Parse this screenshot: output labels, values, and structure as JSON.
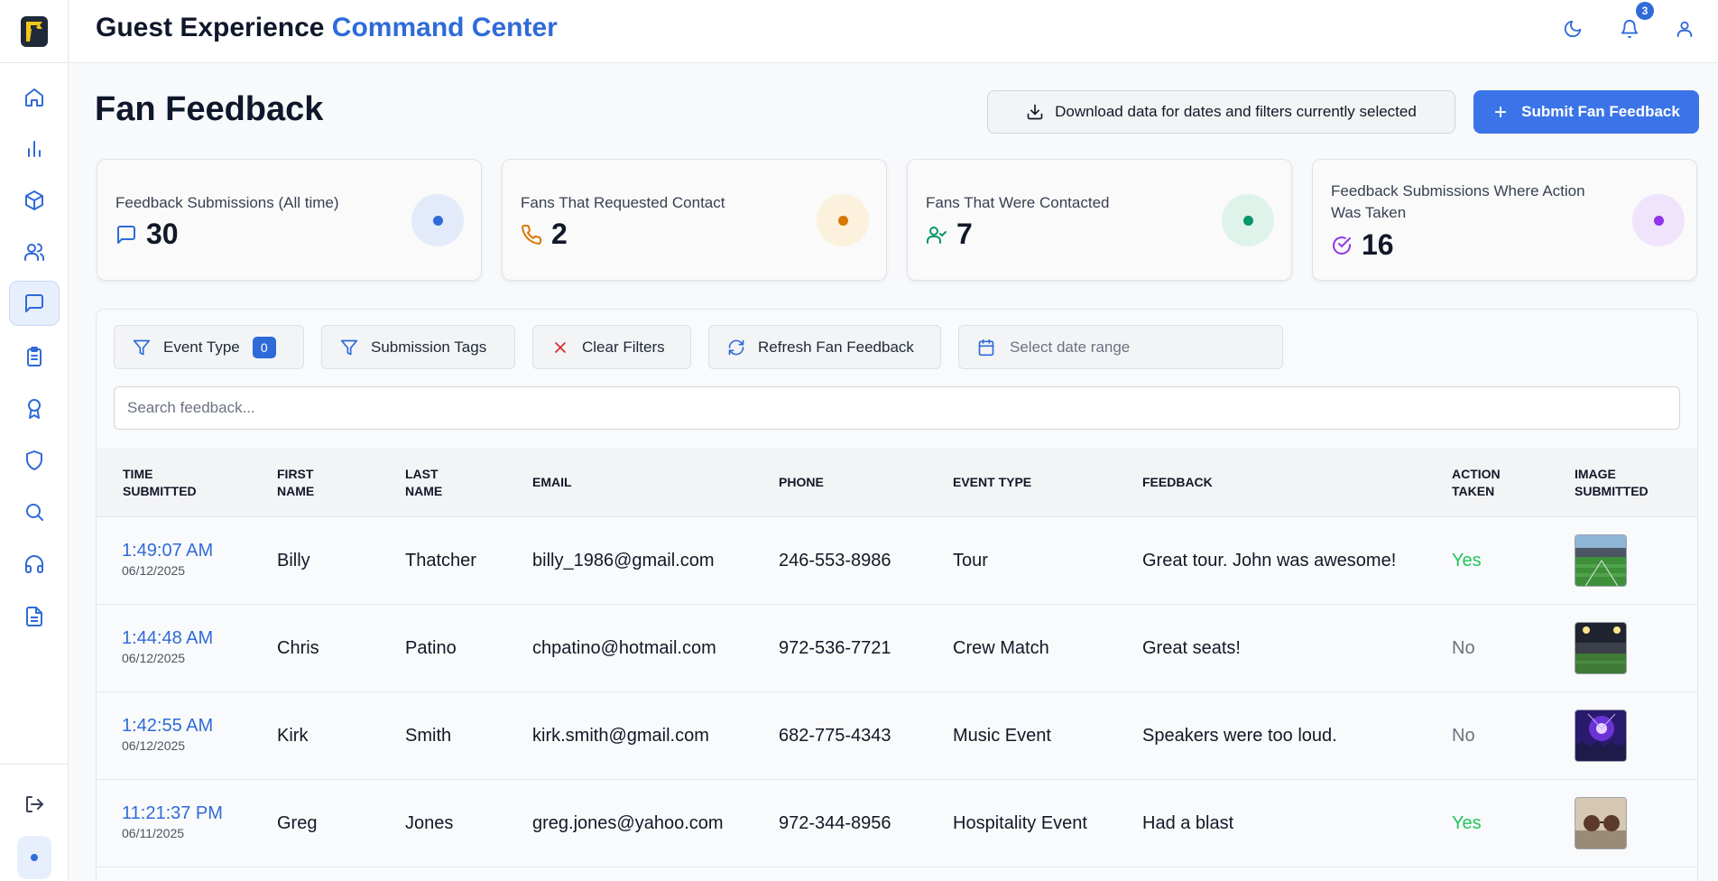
{
  "app": {
    "title_main": "Guest Experience",
    "title_accent": "Command Center",
    "notification_count": "3"
  },
  "page": {
    "title": "Fan Feedback",
    "download_label": "Download data for dates and filters currently selected",
    "submit_label": "Submit Fan Feedback"
  },
  "stats": [
    {
      "label": "Feedback Submissions (All time)",
      "value": "30",
      "icon": "message-icon",
      "color": "#2f6bd8"
    },
    {
      "label": "Fans That Requested Contact",
      "value": "2",
      "icon": "phone-icon",
      "color": "#d97706"
    },
    {
      "label": "Fans That Were Contacted",
      "value": "7",
      "icon": "user-check-icon",
      "color": "#059669"
    },
    {
      "label": "Feedback Submissions Where Action Was Taken",
      "value": "16",
      "icon": "check-circle-icon",
      "color": "#9333ea"
    }
  ],
  "filters": {
    "event_type_label": "Event Type",
    "event_type_count": "0",
    "submission_tags_label": "Submission Tags",
    "clear_label": "Clear Filters",
    "refresh_label": "Refresh Fan Feedback",
    "date_placeholder": "Select date range",
    "search_placeholder": "Search feedback..."
  },
  "table": {
    "headers": [
      "TIME SUBMITTED",
      "FIRST NAME",
      "LAST NAME",
      "EMAIL",
      "PHONE",
      "EVENT TYPE",
      "FEEDBACK",
      "ACTION TAKEN",
      "IMAGE SUBMITTED"
    ],
    "rows": [
      {
        "time": "1:49:07 AM",
        "date": "06/12/2025",
        "first": "Billy",
        "last": "Thatcher",
        "email": "billy_1986@gmail.com",
        "phone": "246-553-8986",
        "event": "Tour",
        "feedback": "Great tour. John was awesome!",
        "action": "Yes",
        "image": "stadium-field-thumbnail"
      },
      {
        "time": "1:44:48 AM",
        "date": "06/12/2025",
        "first": "Chris",
        "last": "Patino",
        "email": "chpatino@hotmail.com",
        "phone": "972-536-7721",
        "event": "Crew Match",
        "feedback": "Great seats!",
        "action": "No",
        "image": "stadium-night-thumbnail"
      },
      {
        "time": "1:42:55 AM",
        "date": "06/12/2025",
        "first": "Kirk",
        "last": "Smith",
        "email": "kirk.smith@gmail.com",
        "phone": "682-775-4343",
        "event": "Music Event",
        "feedback": "Speakers were too loud.",
        "action": "No",
        "image": "concert-thumbnail"
      },
      {
        "time": "11:21:37 PM",
        "date": "06/11/2025",
        "first": "Greg",
        "last": "Jones",
        "email": "greg.jones@yahoo.com",
        "phone": "972-344-8956",
        "event": "Hospitality Event",
        "feedback": "Had a blast",
        "action": "Yes",
        "image": "sunglasses-thumbnail"
      }
    ]
  },
  "colors": {
    "accent": "#2f6bd8",
    "yes": "#22c55e",
    "no": "#6b7280"
  }
}
